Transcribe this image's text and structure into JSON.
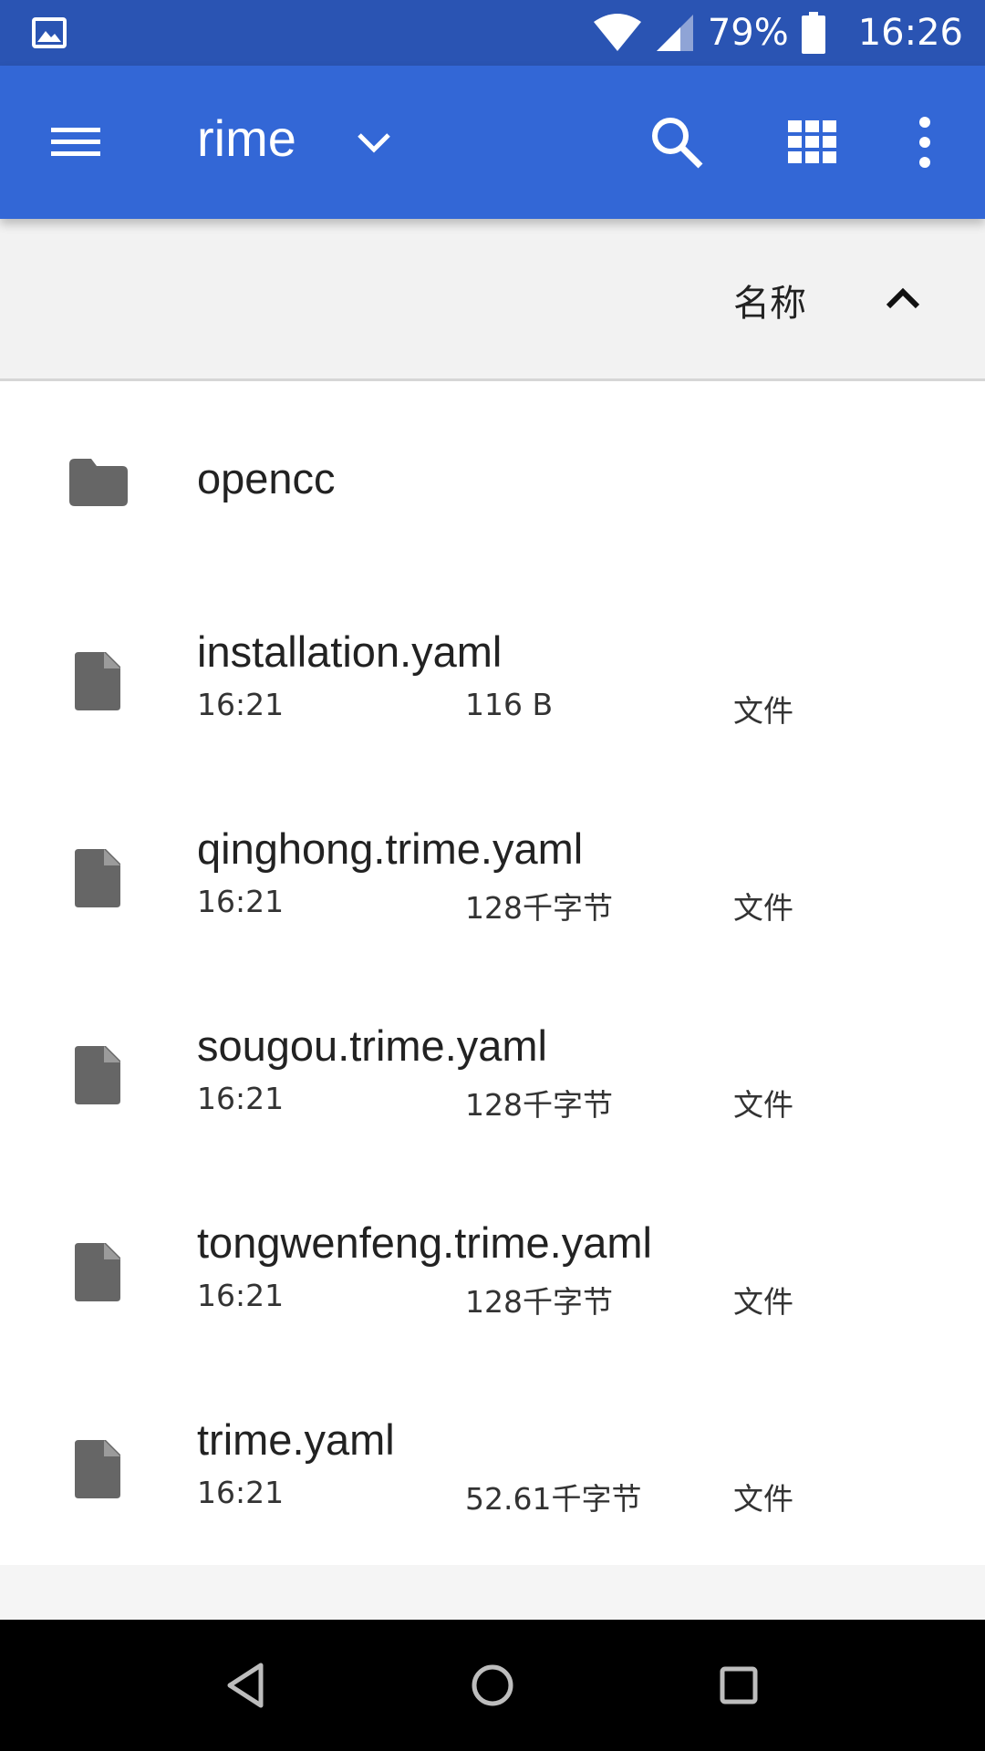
{
  "status_bar": {
    "battery": "79%",
    "time": "16:26",
    "icons": [
      "image-icon",
      "wifi-icon",
      "signal-icon",
      "battery-icon"
    ]
  },
  "app_bar": {
    "title": "rime",
    "icons": [
      "menu-icon",
      "chevron-down-icon",
      "search-icon",
      "grid-view-icon",
      "more-vert-icon"
    ],
    "color": "#3367d6"
  },
  "sort_bar": {
    "label": "名称",
    "direction": "ascending"
  },
  "files": [
    {
      "name": "opencc",
      "kind": "folder"
    },
    {
      "name": "installation.yaml",
      "time": "16:21",
      "size": "116 B",
      "type": "文件",
      "kind": "file"
    },
    {
      "name": "qinghong.trime.yaml",
      "time": "16:21",
      "size": "128千字节",
      "type": "文件",
      "kind": "file"
    },
    {
      "name": "sougou.trime.yaml",
      "time": "16:21",
      "size": "128千字节",
      "type": "文件",
      "kind": "file"
    },
    {
      "name": "tongwenfeng.trime.yaml",
      "time": "16:21",
      "size": "128千字节",
      "type": "文件",
      "kind": "file"
    },
    {
      "name": "trime.yaml",
      "time": "16:21",
      "size": "52.61千字节",
      "type": "文件",
      "kind": "file"
    }
  ],
  "nav_bar": {
    "icons": [
      "back-icon",
      "home-icon",
      "recents-icon"
    ]
  }
}
